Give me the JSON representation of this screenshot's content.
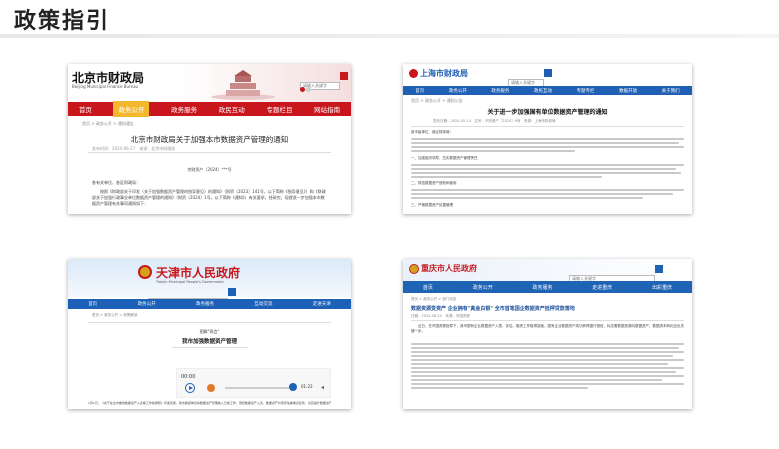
{
  "slide": {
    "title": "政策指引"
  },
  "beijing": {
    "logo": "北京市财政局",
    "logo_sub": "Beijing Municipal Finance Bureau",
    "search_placeholder": "请输入关键字",
    "nav": [
      "首页",
      "政务公开",
      "政务服务",
      "政民互动",
      "专题栏目",
      "网站指南"
    ],
    "breadcrumb": "首页 > 政务公开 > 通知通告",
    "headline": "北京市财政局关于加强本市数据资产管理的通知",
    "meta": "发布时间：2024-06-17　来源：北京市财政局",
    "doc_no": "京财资产〔2024〕***号",
    "salutation": "各有关单位、各区财政局：",
    "para1": "　　按照《财政部关于印发〈关于加强数据资产管理的指导意见〉的通知》（财资〔2023〕141号，以下简称《指导意见》）和《财政部关于加强行政事业单位数据资产管理的通知》（财资〔2024〕1号，以下简称《通知》）有关要求，经研究，现就进一步加强本市数据资产管理有关事项通知如下：",
    "colors": {
      "header": "#c9161c",
      "active": "#f3b82d"
    }
  },
  "shanghai": {
    "logo": "上海市财政局",
    "search_placeholder": "请输入关键字",
    "nav": [
      "首页",
      "政务公开",
      "政务服务",
      "政民互动",
      "专题专栏",
      "数据开放",
      "关于我们"
    ],
    "breadcrumb": "首页 > 政务公开 > 通知公告",
    "headline": "关于进一步加强国有单位数据资产管理的通知",
    "meta": "发布日期：2024-05-14　文号：沪财资产〔2024〕9号　来源：上海市财政局",
    "addressee": "各市级单位、各区财政局：",
    "section1": "一、加强组织领导，压实数据资产管理责任",
    "section2": "二、规范数据资产授权和使用",
    "section3": "三、严格数据资产处置管理",
    "colors": {
      "nav": "#1f5fb4"
    }
  },
  "tianjin": {
    "logo": "天津市人民政府",
    "logo_sub": "Tianjin Municipal People's Government",
    "search_placeholder": "请输入关键字",
    "nav": [
      "首页",
      "政务公开",
      "政务服务",
      "互动交流",
      "走进天津"
    ],
    "breadcrumb": "首页 > 政务公开 > 政策解读",
    "column": "图解\"两会\"",
    "headline": "我市加强数据资产管理",
    "audio_time": "00:00",
    "audio_total": "01:23",
    "body": "1月1日，《关于在全市推动数据资产入表等工作的通知》印发实施，我市各级单位将数据资产管理纳入日常工作，围绕数据资产入表、数据资产价值评估等重点任务，切实提升数据资产管理能力，释放数据要素价值。",
    "colors": {
      "nav": "#1d60b8"
    }
  },
  "chongqing": {
    "logo": "重庆市人民政府",
    "search_placeholder": "请输入关键字",
    "nav": [
      "首页",
      "政务公开",
      "政务服务",
      "走进重庆",
      "出彩重庆"
    ],
    "breadcrumb": "首页 > 政务公开 > 部门动态",
    "headline": "数据资源变资产 企业拥有\"真金白银\" 全市首笔国企数据资产抵押贷款落地",
    "meta": "日期：2024-06-20　来源：市国资委",
    "body": "　　近日，在市国资委指导下，我市国有企业数据资产入表、评估、融资工作取得突破，国有企业数据资产成功获得银行授信，标志着数据资源向数据资产、数据资本转化迈出关键一步。",
    "colors": {
      "nav": "#1f63b5",
      "accent": "#c71d23"
    }
  }
}
